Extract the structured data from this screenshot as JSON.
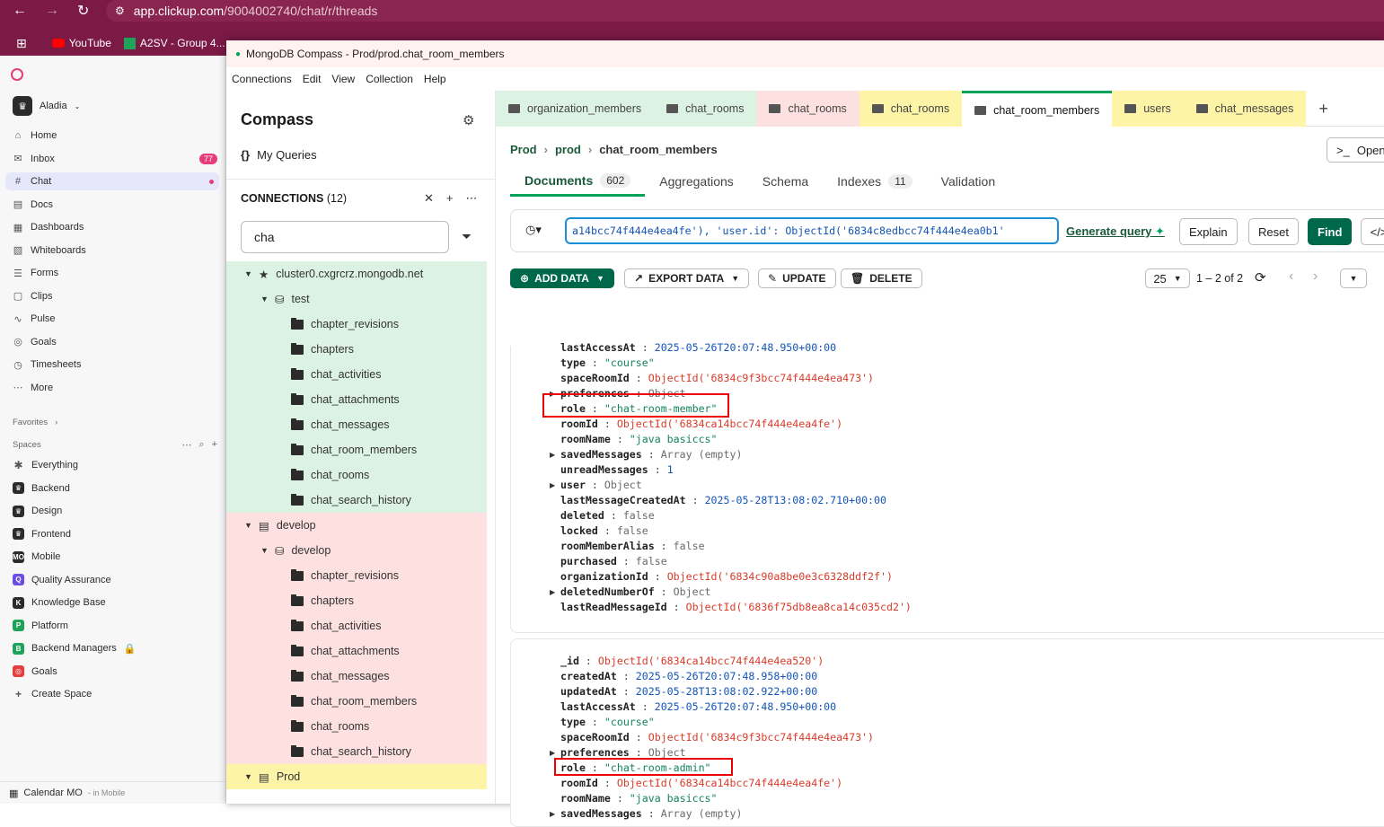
{
  "browser": {
    "url_host": "app.clickup.com",
    "url_path": "/9004002740/chat/r/threads",
    "bookmarks": [
      "YouTube",
      "A2SV - Group 4..."
    ]
  },
  "clickup": {
    "workspace": "Aladia",
    "nav": [
      {
        "label": "Home",
        "icon": "⌂"
      },
      {
        "label": "Inbox",
        "icon": "✉",
        "badge": "77"
      },
      {
        "label": "Chat",
        "icon": "#"
      },
      {
        "label": "Docs",
        "icon": "▤"
      },
      {
        "label": "Dashboards",
        "icon": "▦"
      },
      {
        "label": "Whiteboards",
        "icon": "▧"
      },
      {
        "label": "Forms",
        "icon": "☰"
      },
      {
        "label": "Clips",
        "icon": "▢"
      },
      {
        "label": "Pulse",
        "icon": "∿"
      },
      {
        "label": "Goals",
        "icon": "◎"
      },
      {
        "label": "Timesheets",
        "icon": "◷"
      },
      {
        "label": "More",
        "icon": "⋯"
      }
    ],
    "favorites_label": "Favorites",
    "spaces_label": "Spaces",
    "spaces": [
      {
        "label": "Everything",
        "ic": "✱",
        "color": "#555"
      },
      {
        "label": "Backend",
        "ic": "♛",
        "color": "#2b2b2b"
      },
      {
        "label": "Design",
        "ic": "♛",
        "color": "#2b2b2b"
      },
      {
        "label": "Frontend",
        "ic": "♛",
        "color": "#2b2b2b"
      },
      {
        "label": "Mobile",
        "ic": "MO",
        "color": "#2b2b2b"
      },
      {
        "label": "Quality Assurance",
        "ic": "Q",
        "color": "#6b4de6"
      },
      {
        "label": "Knowledge Base",
        "ic": "K",
        "color": "#2b2b2b"
      },
      {
        "label": "Platform",
        "ic": "P",
        "color": "#1fa35a"
      },
      {
        "label": "Backend Managers",
        "ic": "B",
        "color": "#1fa35a"
      },
      {
        "label": "Goals",
        "ic": "◎",
        "color": "#e53d3d"
      },
      {
        "label": "Create Space",
        "ic": "+",
        "color": "#555"
      }
    ],
    "bottom": "Calendar MO",
    "bottom_sub": "- in Mobile"
  },
  "compass": {
    "title": "MongoDB Compass - Prod/prod.chat_room_members",
    "menu": [
      "Connections",
      "Edit",
      "View",
      "Collection",
      "Help"
    ],
    "sidebar_title": "Compass",
    "my_queries": "My Queries",
    "connections_label": "CONNECTIONS",
    "connections_count": "(12)",
    "filter_value": "cha",
    "clusters": [
      {
        "name": "cluster0.cxgrcrz.mongodb.net",
        "db": "test",
        "bg": "#dcf3e3",
        "collections": [
          "chapter_revisions",
          "chapters",
          "chat_activities",
          "chat_attachments",
          "chat_messages",
          "chat_room_members",
          "chat_rooms",
          "chat_search_history"
        ]
      },
      {
        "name": "develop",
        "db": "develop",
        "bg": "#fde0e0",
        "collections": [
          "chapter_revisions",
          "chapters",
          "chat_activities",
          "chat_attachments",
          "chat_messages",
          "chat_room_members",
          "chat_rooms",
          "chat_search_history"
        ]
      },
      {
        "name": "Prod",
        "bg": "#fdf4a8"
      }
    ],
    "tabs": [
      {
        "label": "organization_members",
        "bg": "#dcf3e3"
      },
      {
        "label": "chat_rooms",
        "bg": "#dcf3e3"
      },
      {
        "label": "chat_rooms",
        "bg": "#fde0e0"
      },
      {
        "label": "chat_rooms",
        "bg": "#fdf4a8"
      },
      {
        "label": "chat_room_members",
        "bg": "#ffffff",
        "active": true
      },
      {
        "label": "users",
        "bg": "#fdf4a8"
      },
      {
        "label": "chat_messages",
        "bg": "#fdf4a8"
      }
    ],
    "breadcrumb": [
      "Prod",
      "prod",
      "chat_room_members"
    ],
    "open_shell": "Open",
    "subtabs": [
      {
        "label": "Documents",
        "count": "602"
      },
      {
        "label": "Aggregations"
      },
      {
        "label": "Schema"
      },
      {
        "label": "Indexes",
        "count": "11"
      },
      {
        "label": "Validation"
      }
    ],
    "query": "a14bcc74f444e4ea4fe'), 'user.id': ObjectId('6834c8edbcc74f444e4ea0b1'",
    "generate_query": "Generate query",
    "explain": "Explain",
    "reset": "Reset",
    "find": "Find",
    "add_data": "ADD DATA",
    "export_data": "EXPORT DATA",
    "update": "UPDATE",
    "delete": "DELETE",
    "page_size": "25",
    "range": "1 – 2 of 2"
  },
  "doc1": [
    {
      "k": "lastAccessAt",
      "v": "2025-05-26T20:07:48.950+00:00",
      "t": "d"
    },
    {
      "k": "type",
      "v": "\"course\"",
      "t": "s"
    },
    {
      "k": "spaceRoomId",
      "v": "ObjectId('6834c9f3bcc74f444e4ea473')",
      "t": "o"
    },
    {
      "k": "preferences",
      "v": "Object",
      "t": "b",
      "c": true
    },
    {
      "k": "role",
      "v": "\"chat-room-member\"",
      "t": "s"
    },
    {
      "k": "roomId",
      "v": "ObjectId('6834ca14bcc74f444e4ea4fe')",
      "t": "o"
    },
    {
      "k": "roomName",
      "v": "\"java basiccs\"",
      "t": "s"
    },
    {
      "k": "savedMessages",
      "v": "Array (empty)",
      "t": "b",
      "c": true
    },
    {
      "k": "unreadMessages",
      "v": "1",
      "t": "n"
    },
    {
      "k": "user",
      "v": "Object",
      "t": "b",
      "c": true
    },
    {
      "k": "lastMessageCreatedAt",
      "v": "2025-05-28T13:08:02.710+00:00",
      "t": "d"
    },
    {
      "k": "deleted",
      "v": "false",
      "t": "b"
    },
    {
      "k": "locked",
      "v": "false",
      "t": "b"
    },
    {
      "k": "roomMemberAlias",
      "v": "false",
      "t": "b"
    },
    {
      "k": "purchased",
      "v": "false",
      "t": "b"
    },
    {
      "k": "organizationId",
      "v": "ObjectId('6834c90a8be0e3c6328ddf2f')",
      "t": "o"
    },
    {
      "k": "deletedNumberOf",
      "v": "Object",
      "t": "b",
      "c": true
    },
    {
      "k": "lastReadMessageId",
      "v": "ObjectId('6836f75db8ea8ca14c035cd2')",
      "t": "o"
    }
  ],
  "doc2": [
    {
      "k": "_id",
      "v": "ObjectId('6834ca14bcc74f444e4ea520')",
      "t": "o"
    },
    {
      "k": "createdAt",
      "v": "2025-05-26T20:07:48.958+00:00",
      "t": "d"
    },
    {
      "k": "updatedAt",
      "v": "2025-05-28T13:08:02.922+00:00",
      "t": "d"
    },
    {
      "k": "lastAccessAt",
      "v": "2025-05-26T20:07:48.950+00:00",
      "t": "d"
    },
    {
      "k": "type",
      "v": "\"course\"",
      "t": "s"
    },
    {
      "k": "spaceRoomId",
      "v": "ObjectId('6834c9f3bcc74f444e4ea473')",
      "t": "o"
    },
    {
      "k": "preferences",
      "v": "Object",
      "t": "b",
      "c": true
    },
    {
      "k": "role",
      "v": "\"chat-room-admin\"",
      "t": "s"
    },
    {
      "k": "roomId",
      "v": "ObjectId('6834ca14bcc74f444e4ea4fe')",
      "t": "o"
    },
    {
      "k": "roomName",
      "v": "\"java basiccs\"",
      "t": "s"
    },
    {
      "k": "savedMessages",
      "v": "Array (empty)",
      "t": "b",
      "c": true
    }
  ]
}
